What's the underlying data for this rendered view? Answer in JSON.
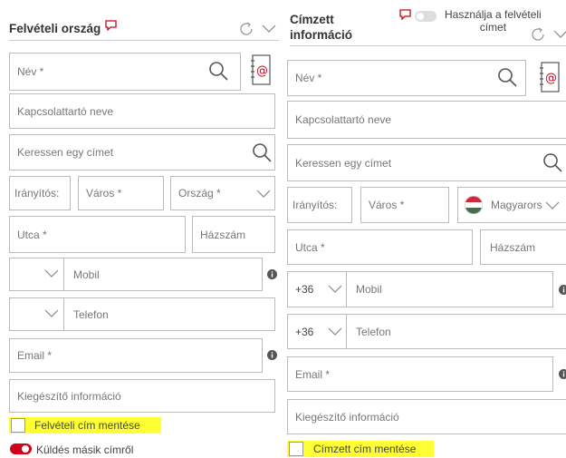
{
  "colors": {
    "accent": "#d0021b",
    "highlight": "#ffff33",
    "border": "#bbbbbb",
    "info": "#555555"
  },
  "left": {
    "title": "Felvételi ország",
    "fields": {
      "name": "Név *",
      "contact": "Kapcsolattartó neve",
      "search": "Keressen egy címet",
      "zip": "Irányítós:",
      "city": "Város *",
      "country": "Ország *",
      "street": "Utca *",
      "house": "Házszám",
      "mobile_prefix": "",
      "mobile": "Mobil",
      "phone_prefix": "",
      "phone": "Telefon",
      "email": "Email *",
      "extra": "Kiegészítő információ"
    },
    "save_label": "Felvételi cím mentése",
    "send_other_label": "Küldés másik címről",
    "send_other_toggle": true
  },
  "right": {
    "title_line1": "Címzett",
    "title_line2": "információ",
    "use_pickup_line1": "Használja a felvételi",
    "use_pickup_line2": "címet",
    "use_pickup_toggle": false,
    "fields": {
      "name": "Név *",
      "contact": "Kapcsolattartó neve",
      "search": "Keressen egy címet",
      "zip": "Irányítós:",
      "city": "Város *",
      "country": "Magyarors",
      "street": "Utca *",
      "house": "Házszám",
      "mobile_prefix": "+36",
      "mobile": "Mobil",
      "phone_prefix": "+36",
      "phone": "Telefon",
      "email": "Email *",
      "extra": "Kiegészítő információ"
    },
    "save_label": "Címzett cím mentése"
  },
  "icons": {
    "comment": "comment-icon",
    "refresh": "refresh-icon",
    "chevron": "chevron-down-icon",
    "search": "search-icon",
    "contacts": "contact-book-icon",
    "info": "info-icon",
    "flag": "hungary-flag-icon"
  }
}
